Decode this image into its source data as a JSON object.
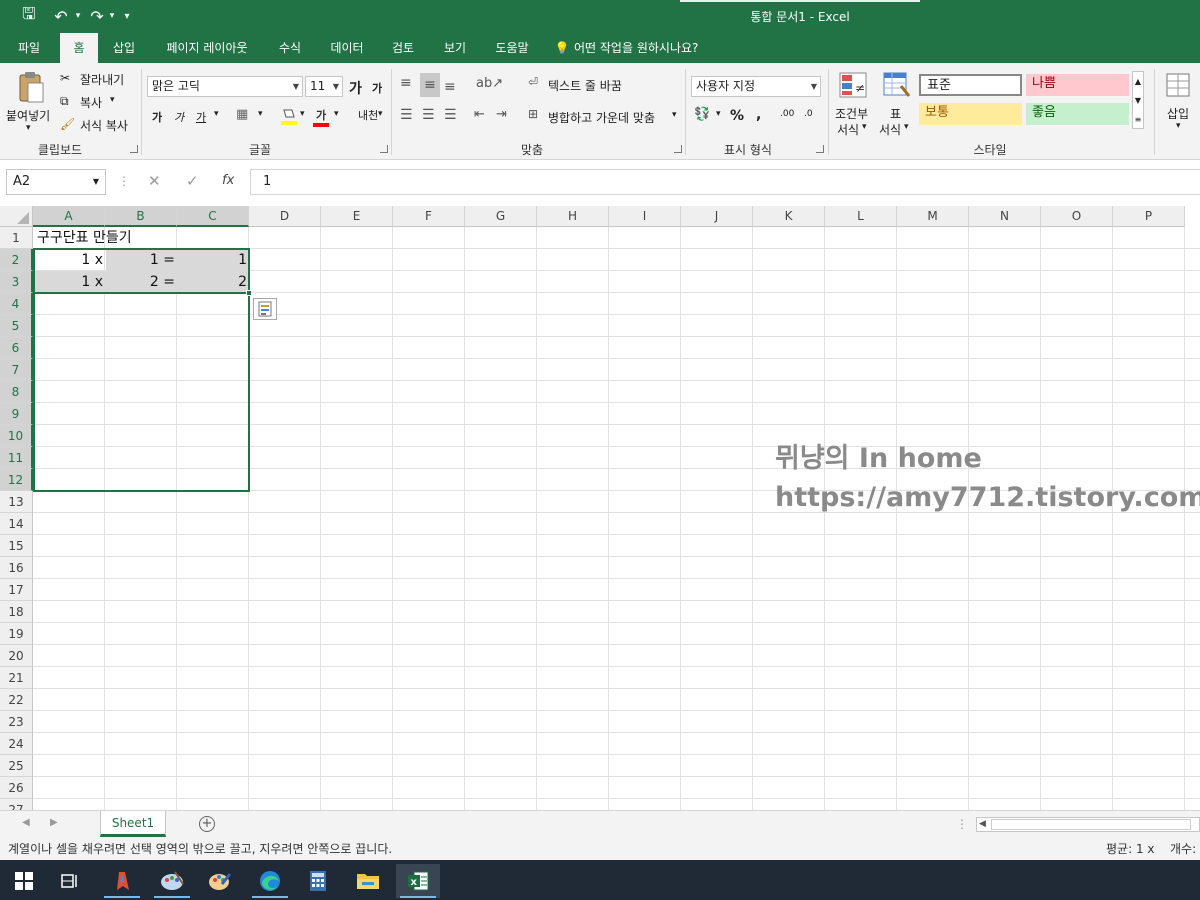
{
  "window": {
    "title": "통합 문서1  -  Excel",
    "qa_save": "🖫",
    "qa_undo": "↶",
    "qa_redo": "↷",
    "qa_customize": "▾"
  },
  "tabs": [
    "파일",
    "홈",
    "삽입",
    "페이지 레이아웃",
    "수식",
    "데이터",
    "검토",
    "보기",
    "도움말"
  ],
  "tell_me": "어떤 작업을 원하시나요?",
  "ribbon": {
    "clipboard": {
      "paste_label": "붙여넣기",
      "cut_label": "잘라내기",
      "copy_label": "복사",
      "format_painter_label": "서식 복사",
      "group_label": "클립보드"
    },
    "font": {
      "font_name": "맑은 고딕",
      "font_size": "11",
      "grow_font": "가",
      "shrink_font": "가",
      "bold": "가",
      "italic": "가",
      "underline": "가",
      "font_color": "가",
      "phonetic": "내천",
      "group_label": "글꼴"
    },
    "alignment": {
      "wrap_text_label": "텍스트 줄 바꿈",
      "merge_center_label": "병합하고 가운데 맞춤",
      "group_label": "맞춤"
    },
    "number": {
      "format": "사용자 지정",
      "percent": "%",
      "comma": ",",
      "increase_decimal": ".00",
      "decrease_decimal": ".0",
      "group_label": "표시 형식"
    },
    "styles": {
      "conditional_label_1": "조건부",
      "conditional_label_2": "서식",
      "table_label_1": "표",
      "table_label_2": "서식",
      "normal": "표준",
      "bad": "나쁨",
      "neutral": "보통",
      "good": "좋음",
      "group_label": "스타일"
    },
    "cells": {
      "insert_label": "삽입"
    }
  },
  "formula_bar": {
    "name_box": "A2",
    "fx": "fx",
    "value": "1"
  },
  "columns": [
    "A",
    "B",
    "C",
    "D",
    "E",
    "F",
    "G",
    "H",
    "I",
    "J",
    "K",
    "L",
    "M",
    "N",
    "O",
    "P"
  ],
  "rows": [
    "1",
    "2",
    "3",
    "4",
    "5",
    "6",
    "7",
    "8",
    "9",
    "10",
    "11",
    "12",
    "13",
    "14",
    "15",
    "16",
    "17",
    "18",
    "19",
    "20",
    "21",
    "22",
    "23",
    "24",
    "25",
    "26",
    "27"
  ],
  "cells": {
    "A1": "구구단표 만들기",
    "A2": "1 x",
    "B2": "1 =",
    "C2": "1",
    "A3": "1 x",
    "B3": "2 =",
    "C3": "2"
  },
  "watermark": {
    "line1": "뮈냥의 In home",
    "line2": "https://amy7712.tistory.com"
  },
  "sheet_tabs": [
    "Sheet1"
  ],
  "status": {
    "message": "계열이나 셀을 채우려면 선택 영역의 밖으로 끌고, 지우려면 안쪽으로 끕니다.",
    "average": "평균: 1 x",
    "count": "개수:"
  },
  "taskbar": {
    "icons": [
      "windows-start-icon",
      "task-view-icon",
      "app-icon",
      "paint-icon",
      "paint-3d-icon",
      "edge-icon",
      "calculator-icon",
      "file-explorer-icon",
      "excel-icon"
    ]
  },
  "colors": {
    "excel_green": "#217346",
    "selection_border": "#217346",
    "bad_fill": "#ffc7ce",
    "bad_text": "#9c0006",
    "neutral_fill": "#ffeb9c",
    "neutral_text": "#9c5700",
    "good_fill": "#c6efce",
    "good_text": "#006100"
  }
}
